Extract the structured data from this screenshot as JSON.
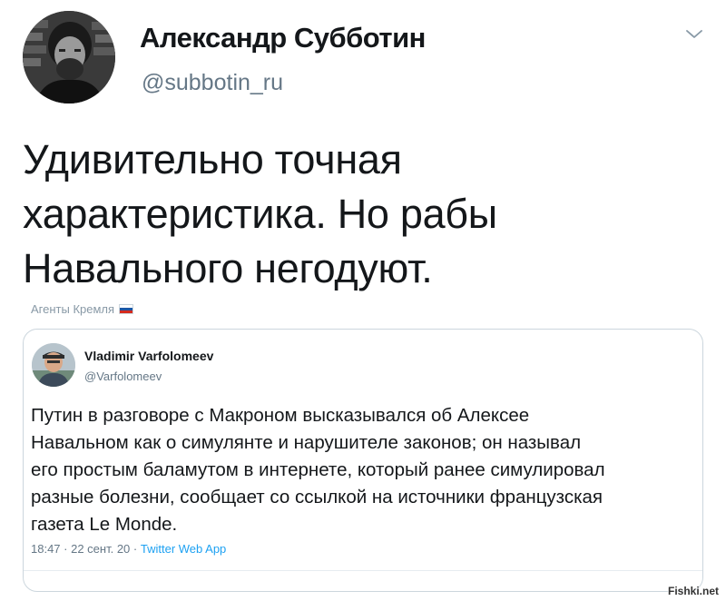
{
  "tweet": {
    "author": {
      "display_name": "Александр Субботин",
      "handle": "@subbotin_ru",
      "avatar_icon": "user-avatar-photo"
    },
    "menu_icon": "chevron-down-icon",
    "text_lines": [
      "Удивительно точная",
      "характеристика. Но рабы",
      "Навального негодуют."
    ],
    "label": "Агенты Кремля",
    "label_icon": "russian-flag-icon"
  },
  "quoted_tweet": {
    "author": {
      "display_name": "Vladimir Varfolomeev",
      "handle": "@Varfolomeev",
      "avatar_icon": "user-avatar-photo"
    },
    "text_lines": [
      "Путин в разговоре с Макроном высказывался об Алексее",
      "Навальном как о симулянте и нарушителе законов; он называл",
      "его простым баламутом в интернете, который ранее симулировал",
      "разные болезни, сообщает со ссылкой на источники французская",
      "газета Le Monde."
    ],
    "time": "18:47",
    "date": "22 сент. 20",
    "app": "Twitter Web App",
    "separator": " · "
  },
  "watermark": "Fishki.net",
  "colors": {
    "text": "#14171a",
    "secondary": "#657786",
    "link": "#1da1f2",
    "border": "#ccd6dd"
  }
}
